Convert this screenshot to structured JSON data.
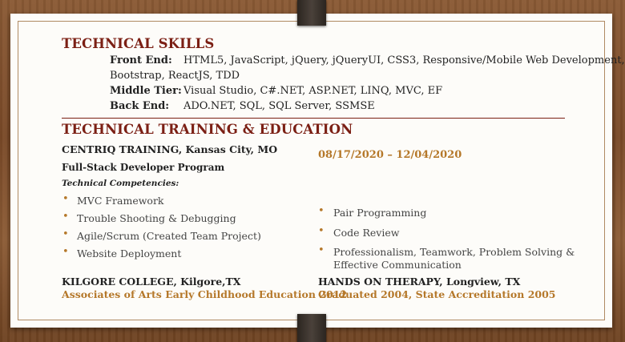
{
  "skills": {
    "heading": "TECHNICAL SKILLS",
    "front_end_label": "Front End:",
    "front_end_value_line1": "HTML5, JavaScript, jQuery, jQueryUI, CSS3, Responsive/Mobile Web Development,",
    "front_end_value_line2": "Bootstrap, ReactJS, TDD",
    "middle_tier_label": "Middle Tier:",
    "middle_tier_value": "Visual Studio, C#.NET, ASP.NET, LINQ, MVC, EF",
    "back_end_label": "Back End:",
    "back_end_value": "ADO.NET, SQL, SQL Server, SSMSE"
  },
  "training": {
    "heading": "TECHNICAL TRAINING & EDUCATION",
    "centriq": "CENTRIQ TRAINING, Kansas City, MO",
    "dates": "08/17/2020 – 12/04/2020",
    "program": "Full-Stack Developer Program",
    "competencies_label": "Technical Competencies:",
    "left_bullets": [
      "MVC Framework",
      "Trouble Shooting & Debugging",
      "Agile/Scrum (Created Team Project)",
      "Website Deployment"
    ],
    "right_bullets": [
      "Pair Programming",
      "Code Review",
      "Professionalism, Teamwork, Problem Solving &",
      "Effective Communication"
    ],
    "kilgore": "KILGORE COLLEGE, Kilgore,TX",
    "kilgore_degree": "Associates of Arts Early Childhood Education 2012",
    "hot": "HANDS ON THERAPY, Longview, TX",
    "hot_detail": "Graduated 2004, State Accreditation 2005"
  }
}
